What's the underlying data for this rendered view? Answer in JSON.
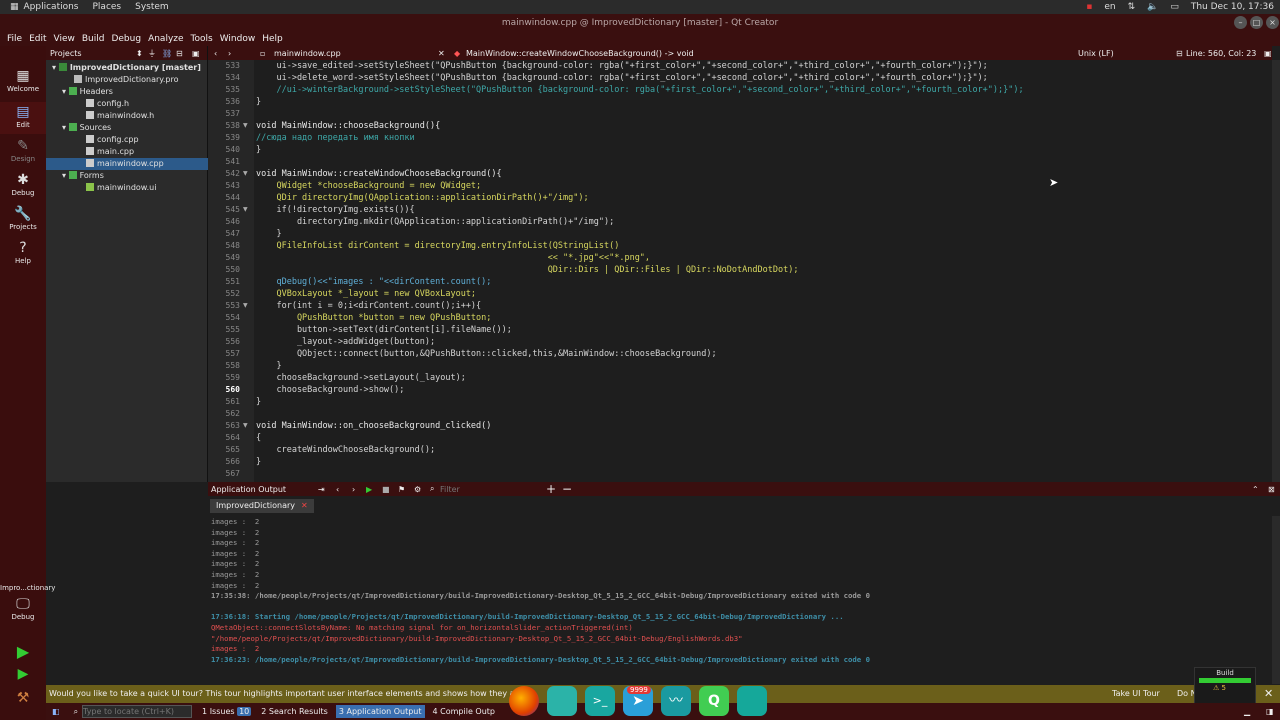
{
  "system_bar": {
    "applications": "Applications",
    "places": "Places",
    "system": "System",
    "lang": "en",
    "clock": "Thu Dec 10, 17:36"
  },
  "window_title": "mainwindow.cpp @ ImprovedDictionary [master] - Qt Creator",
  "menu": [
    "File",
    "Edit",
    "View",
    "Build",
    "Debug",
    "Analyze",
    "Tools",
    "Window",
    "Help"
  ],
  "modes": [
    {
      "label": "Welcome",
      "icon": "grid-icon"
    },
    {
      "label": "Edit",
      "icon": "edit-icon"
    },
    {
      "label": "Design",
      "icon": "pen-icon"
    },
    {
      "label": "Debug",
      "icon": "bug-icon"
    },
    {
      "label": "Projects",
      "icon": "wrench-icon"
    },
    {
      "label": "Help",
      "icon": "help-icon"
    }
  ],
  "kit": {
    "name": "Impro...ctionary",
    "label": "Debug"
  },
  "projects": {
    "header": "Projects",
    "items": [
      {
        "label": "ImprovedDictionary [master]",
        "bold": true
      },
      {
        "label": "ImprovedDictionary.pro"
      },
      {
        "label": "Headers"
      },
      {
        "label": "config.h"
      },
      {
        "label": "mainwindow.h"
      },
      {
        "label": "Sources"
      },
      {
        "label": "config.cpp"
      },
      {
        "label": "main.cpp"
      },
      {
        "label": "mainwindow.cpp",
        "selected": true
      },
      {
        "label": "Forms"
      },
      {
        "label": "mainwindow.ui"
      }
    ]
  },
  "editor": {
    "file": "mainwindow.cpp",
    "symbol": "MainWindow::createWindowChooseBackground() -> void",
    "line_ending": "Unix (LF)",
    "position": "Line: 560, Col: 23",
    "line_numbers": [
      "533",
      "534",
      "535",
      "536",
      "537",
      "538",
      "539",
      "540",
      "541",
      "542",
      "543",
      "544",
      "545",
      "546",
      "547",
      "548",
      "549",
      "550",
      "551",
      "552",
      "553",
      "554",
      "555",
      "556",
      "557",
      "558",
      "559",
      "560",
      "561",
      "562",
      "563",
      "564",
      "565",
      "566",
      "567"
    ],
    "lines": [
      "    ui->save_edited->setStyleSheet(\"QPushButton {background-color: rgba(\"+first_color+\",\"+second_color+\",\"+third_color+\",\"+fourth_color+\");}\");",
      "    ui->delete_word->setStyleSheet(\"QPushButton {background-color: rgba(\"+first_color+\",\"+second_color+\",\"+third_color+\",\"+fourth_color+\");}\");",
      "    //ui->winterBackground->setStyleSheet(\"QPushButton {background-color: rgba(\"+first_color+\",\"+second_color+\",\"+third_color+\",\"+fourth_color+\");}\");",
      "}",
      "",
      "void MainWindow::chooseBackground(){",
      "//сюда надо передать имя кнопки",
      "}",
      "",
      "void MainWindow::createWindowChooseBackground(){",
      "    QWidget *chooseBackground = new QWidget;",
      "    QDir directoryImg(QApplication::applicationDirPath()+\"/img\");",
      "    if(!directoryImg.exists()){",
      "        directoryImg.mkdir(QApplication::applicationDirPath()+\"/img\");",
      "    }",
      "    QFileInfoList dirContent = directoryImg.entryInfoList(QStringList()",
      "                                                         << \"*.jpg\"<<\"*.png\",",
      "                                                         QDir::Dirs | QDir::Files | QDir::NoDotAndDotDot);",
      "    qDebug()<<\"images : \"<<dirContent.count();",
      "    QVBoxLayout *_layout = new QVBoxLayout;",
      "    for(int i = 0;i<dirContent.count();i++){",
      "        QPushButton *button = new QPushButton;",
      "        button->setText(dirContent[i].fileName());",
      "        _layout->addWidget(button);",
      "        QObject::connect(button,&QPushButton::clicked,this,&MainWindow::chooseBackground);",
      "    }",
      "    chooseBackground->setLayout(_layout);",
      "    chooseBackground->show();",
      "}",
      "",
      "void MainWindow::on_chooseBackground_clicked()",
      "{",
      "    createWindowChooseBackground();",
      "}",
      ""
    ]
  },
  "output": {
    "title": "Application Output",
    "filter_placeholder": "Filter",
    "tab": "ImprovedDictionary",
    "lines": [
      {
        "text": "images :  2",
        "color": "#9a9a9a"
      },
      {
        "text": "images :  2",
        "color": "#9a9a9a"
      },
      {
        "text": "images :  2",
        "color": "#9a9a9a"
      },
      {
        "text": "images :  2",
        "color": "#9a9a9a"
      },
      {
        "text": "images :  2",
        "color": "#9a9a9a"
      },
      {
        "text": "images :  2",
        "color": "#9a9a9a"
      },
      {
        "text": "images :  2",
        "color": "#9a9a9a"
      },
      {
        "text": "17:35:38: /home/people/Projects/qt/ImprovedDictionary/build-ImprovedDictionary-Desktop_Qt_5_15_2_GCC_64bit-Debug/ImprovedDictionary exited with code 0",
        "color": "#9a9a9a",
        "bold": true
      },
      {
        "text": "",
        "color": "#9a9a9a"
      },
      {
        "text": "17:36:18: Starting /home/people/Projects/qt/ImprovedDictionary/build-ImprovedDictionary-Desktop_Qt_5_15_2_GCC_64bit-Debug/ImprovedDictionary ...",
        "color": "#3e8fa8",
        "bold": true
      },
      {
        "text": "QMetaObject::connectSlotsByName: No matching signal for on_horizontalSlider_actionTriggered(int)",
        "color": "#e05050"
      },
      {
        "text": "\"/home/people/Projects/qt/ImprovedDictionary/build-ImprovedDictionary-Desktop_Qt_5_15_2_GCC_64bit-Debug/EnglishWords.db3\"",
        "color": "#e05050"
      },
      {
        "text": "images :  2",
        "color": "#e05050"
      },
      {
        "text": "17:36:23: /home/people/Projects/qt/ImprovedDictionary/build-ImprovedDictionary-Desktop_Qt_5_15_2_GCC_64bit-Debug/ImprovedDictionary exited with code 0",
        "color": "#3e8fa8",
        "bold": true
      }
    ]
  },
  "tour": {
    "message": "Would you like to take a quick UI tour? This tour highlights important user interface elements and shows how they are us",
    "take_tour": "Take UI Tour",
    "dont_show": "Do N"
  },
  "status": {
    "locator_placeholder": "Type to locate (Ctrl+K)",
    "tabs": [
      {
        "num": "1",
        "label": "Issues",
        "badge": "10"
      },
      {
        "num": "2",
        "label": "Search Results"
      },
      {
        "num": "3",
        "label": "Application Output",
        "active": true
      },
      {
        "num": "4",
        "label": "Compile Outp"
      }
    ]
  },
  "build_badge": {
    "label": "Build",
    "warn_count": "5"
  },
  "dock": {
    "badge": "9999"
  }
}
